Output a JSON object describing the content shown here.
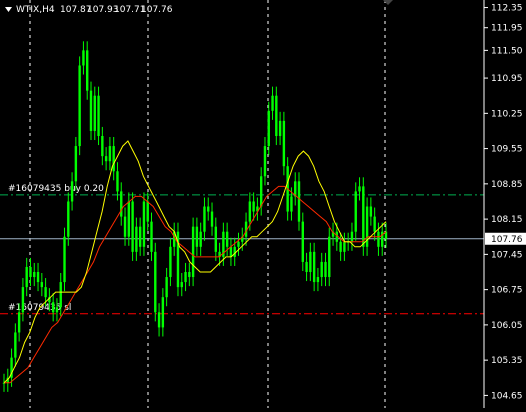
{
  "header": {
    "symbol": "WTIX,H4",
    "open": "107.87",
    "high": "107.93",
    "low": "107.71",
    "close": "107.76"
  },
  "colors": {
    "background": "#000000",
    "candle": "#00ff00",
    "ma_fast": "#ffff00",
    "ma_slow": "#ff2a00",
    "buy_line": "#00b050",
    "sell_line": "#ff0000",
    "bid_line": "#a0b4c8",
    "grid": "#ffffff"
  },
  "icons": {
    "menu": "triangle-down-icon",
    "scroll": "triangle-up-icon"
  },
  "price_label": "107.76",
  "orders": [
    {
      "text": "#16079435 buy 0.20",
      "price": 108.63,
      "color_key": "buy_line"
    },
    {
      "text": "#16079435 sl",
      "price": 106.27,
      "color_key": "sell_line"
    }
  ],
  "chart_data": {
    "type": "line",
    "title": "WTIX,H4",
    "ylim": [
      104.4,
      112.5
    ],
    "y_ticks": [
      "112.35",
      "111.95",
      "111.50",
      "110.95",
      "110.25",
      "109.55",
      "108.85",
      "108.15",
      "107.45",
      "106.75",
      "106.05",
      "105.35",
      "104.65"
    ],
    "bid": 107.76,
    "close_series": [
      104.9,
      105.0,
      105.4,
      105.9,
      106.3,
      106.8,
      107.2,
      107.0,
      107.1,
      106.9,
      106.8,
      106.6,
      106.5,
      106.3,
      106.4,
      106.9,
      107.8,
      108.5,
      108.9,
      109.6,
      111.2,
      111.5,
      110.7,
      109.9,
      110.6,
      109.8,
      109.4,
      109.3,
      109.6,
      109.1,
      108.7,
      108.2,
      107.8,
      108.5,
      107.5,
      108.0,
      107.6,
      108.5,
      108.1,
      107.5,
      106.3,
      106.0,
      106.6,
      107.0,
      107.6,
      107.9,
      106.8,
      106.9,
      107.1,
      107.0,
      108.0,
      107.6,
      107.9,
      108.4,
      108.3,
      108.0,
      107.5,
      107.4,
      107.9,
      107.6,
      107.4,
      107.6,
      107.7,
      107.8,
      108.1,
      108.5,
      108.3,
      108.4,
      109.0,
      109.6,
      110.3,
      110.6,
      109.8,
      110.1,
      109.2,
      108.3,
      108.6,
      108.9,
      108.1,
      107.3,
      107.1,
      107.5,
      106.9,
      107.0,
      107.3,
      107.0,
      107.8,
      107.9,
      107.7,
      107.5,
      107.7,
      107.7,
      107.9,
      108.7,
      108.8,
      107.6,
      108.4,
      108.2,
      107.9,
      107.6,
      107.9,
      107.76
    ],
    "ma_fast": [
      104.9,
      105.0,
      105.2,
      105.4,
      105.7,
      105.9,
      106.2,
      106.4,
      106.5,
      106.6,
      106.7,
      106.7,
      106.7,
      106.7,
      106.7,
      106.8,
      107.1,
      107.5,
      107.9,
      108.3,
      108.8,
      109.2,
      109.4,
      109.6,
      109.7,
      109.5,
      109.3,
      109.0,
      108.8,
      108.6,
      108.4,
      108.2,
      108.0,
      107.9,
      107.6,
      107.5,
      107.3,
      107.2,
      107.1,
      107.1,
      107.1,
      107.2,
      107.3,
      107.4,
      107.4,
      107.5,
      107.6,
      107.7,
      107.8,
      107.8,
      107.9,
      108.0,
      108.1,
      108.3,
      108.6,
      108.9,
      109.2,
      109.4,
      109.5,
      109.4,
      109.2,
      108.9,
      108.7,
      108.4,
      108.1,
      107.9,
      107.7,
      107.7,
      107.6,
      107.6,
      107.7,
      107.8,
      107.9,
      108.0,
      108.1
    ],
    "ma_slow": [
      104.9,
      104.9,
      105.0,
      105.1,
      105.2,
      105.4,
      105.6,
      105.8,
      106.0,
      106.1,
      106.3,
      106.5,
      106.7,
      106.9,
      107.1,
      107.3,
      107.6,
      107.8,
      108.0,
      108.2,
      108.4,
      108.5,
      108.6,
      108.6,
      108.5,
      108.4,
      108.2,
      108.0,
      107.9,
      107.7,
      107.6,
      107.5,
      107.4,
      107.4,
      107.4,
      107.4,
      107.4,
      107.5,
      107.6,
      107.7,
      107.8,
      108.0,
      108.2,
      108.4,
      108.6,
      108.7,
      108.8,
      108.8,
      108.7,
      108.6,
      108.5,
      108.4,
      108.3,
      108.2,
      108.1,
      107.9,
      107.8,
      107.7,
      107.7,
      107.7,
      107.7,
      107.8,
      107.8,
      107.8,
      107.9
    ]
  }
}
